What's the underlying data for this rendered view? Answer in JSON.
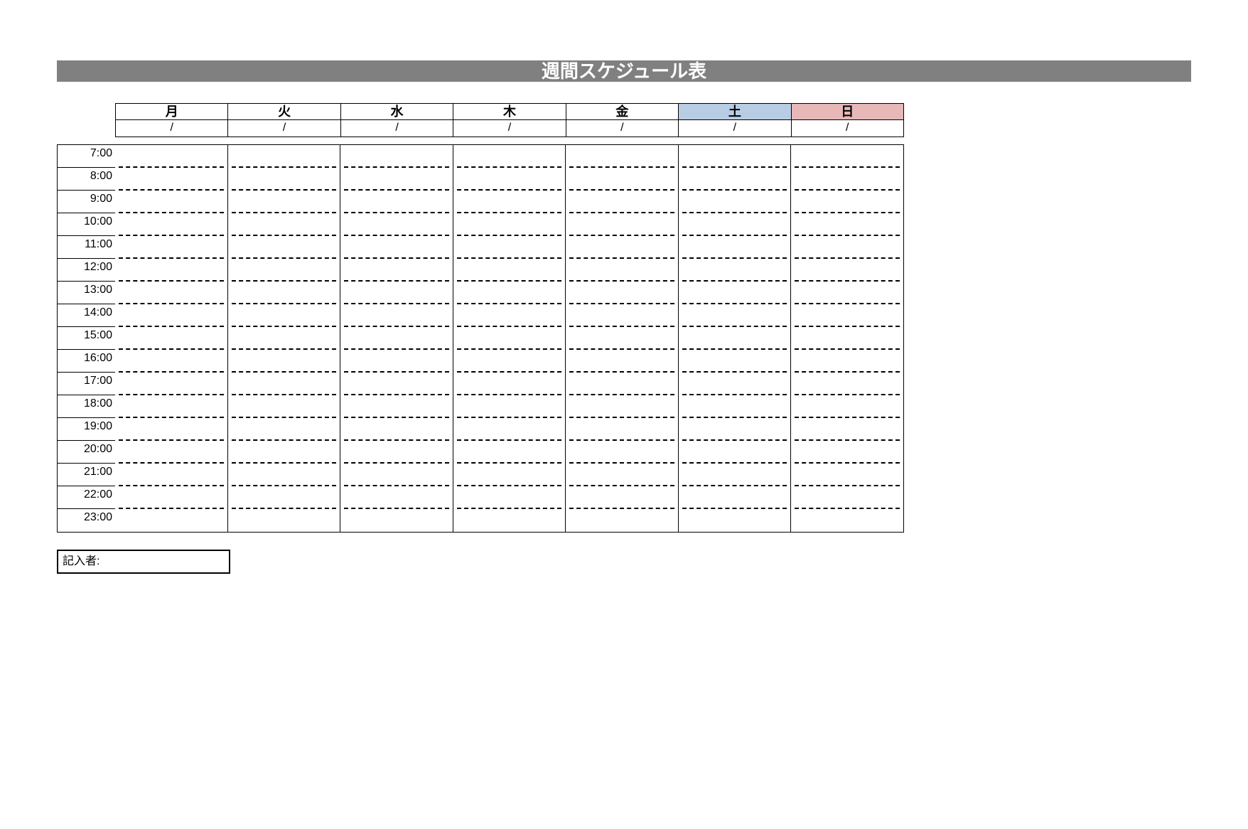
{
  "title": "週間スケジュール表",
  "days": [
    "月",
    "火",
    "水",
    "木",
    "金",
    "土",
    "日"
  ],
  "dates": [
    "/",
    "/",
    "/",
    "/",
    "/",
    "/",
    "/"
  ],
  "times": [
    "7:00",
    "8:00",
    "9:00",
    "10:00",
    "11:00",
    "12:00",
    "13:00",
    "14:00",
    "15:00",
    "16:00",
    "17:00",
    "18:00",
    "19:00",
    "20:00",
    "21:00",
    "22:00",
    "23:00"
  ],
  "author_label": "記入者:",
  "author_value": "",
  "colors": {
    "saturday": "#b8cce4",
    "sunday": "#e6b8b7",
    "title_bg": "#808080"
  }
}
